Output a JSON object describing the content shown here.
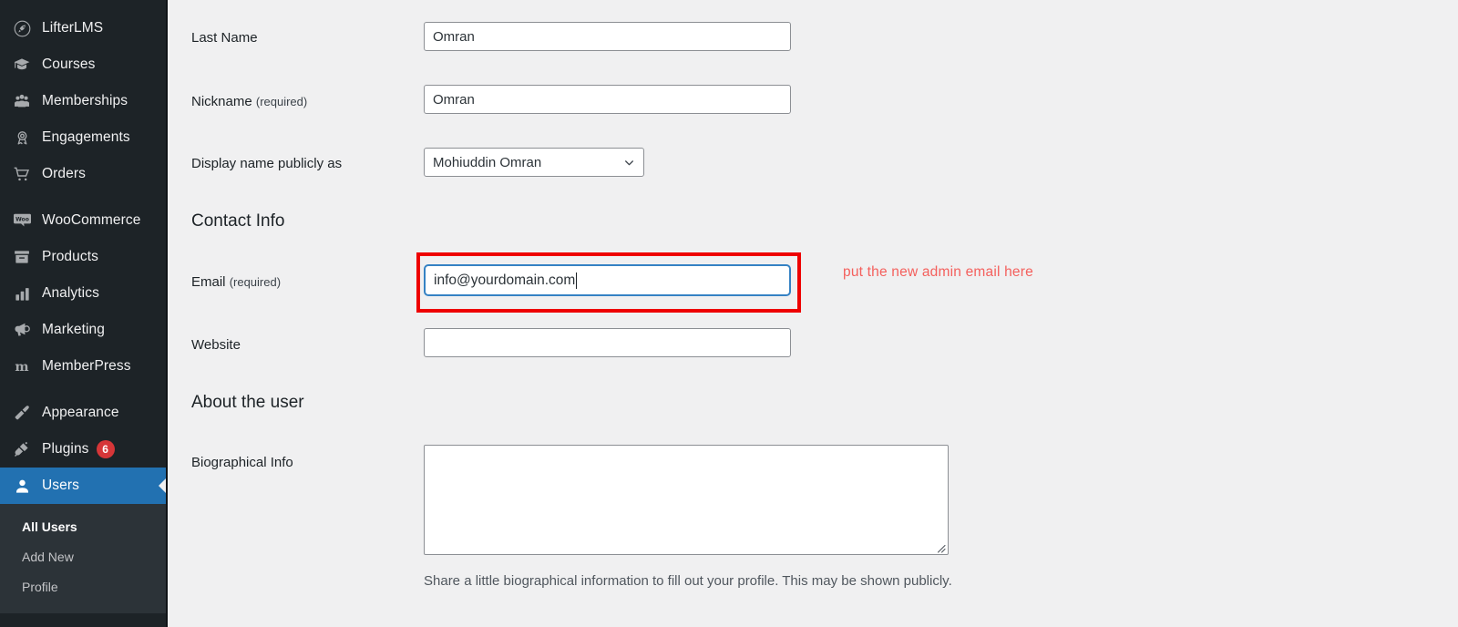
{
  "colors": {
    "sidebar_bg": "#1d2327",
    "submenu_bg": "#2c3338",
    "active_blue": "#2271b1",
    "badge_red": "#d63638",
    "highlight_red": "#ee0000",
    "annotation_red": "#f4605d",
    "focus_blue": "#3582c4",
    "content_bg": "#f0f0f1"
  },
  "sidebar": {
    "groups": [
      {
        "items": [
          {
            "label": "LifterLMS",
            "icon": "rocket-icon",
            "active": false
          },
          {
            "label": "Courses",
            "icon": "graduation-cap-icon",
            "active": false
          },
          {
            "label": "Memberships",
            "icon": "group-icon",
            "active": false
          },
          {
            "label": "Engagements",
            "icon": "award-ribbon-icon",
            "active": false
          },
          {
            "label": "Orders",
            "icon": "shopping-cart-icon",
            "active": false
          }
        ]
      },
      {
        "items": [
          {
            "label": "WooCommerce",
            "icon": "woo-icon",
            "active": false
          },
          {
            "label": "Products",
            "icon": "archive-box-icon",
            "active": false
          },
          {
            "label": "Analytics",
            "icon": "bar-chart-icon",
            "active": false
          },
          {
            "label": "Marketing",
            "icon": "megaphone-icon",
            "active": false
          },
          {
            "label": "MemberPress",
            "icon": "memberpress-m-icon",
            "active": false
          }
        ]
      },
      {
        "items": [
          {
            "label": "Appearance",
            "icon": "paintbrush-icon",
            "active": false
          },
          {
            "label": "Plugins",
            "icon": "plug-icon",
            "active": false,
            "badge": "6"
          },
          {
            "label": "Users",
            "icon": "user-icon",
            "active": true
          }
        ]
      }
    ],
    "submenu": [
      {
        "label": "All Users",
        "current": true
      },
      {
        "label": "Add New",
        "current": false
      },
      {
        "label": "Profile",
        "current": false
      }
    ]
  },
  "form": {
    "last_name": {
      "label": "Last Name",
      "value": "Omran",
      "placeholder": ""
    },
    "nickname": {
      "label": "Nickname",
      "required_note": "(required)",
      "value": "Omran",
      "placeholder": ""
    },
    "display_name": {
      "label": "Display name publicly as",
      "selected": "Mohiuddin Omran",
      "chevron": "chevron-down-icon"
    },
    "contact_info_heading": "Contact Info",
    "email": {
      "label": "Email",
      "required_note": "(required)",
      "value": "info@yourdomain.com",
      "placeholder": ""
    },
    "website": {
      "label": "Website",
      "value": "",
      "placeholder": ""
    },
    "about_heading": "About the user",
    "biographical_info": {
      "label": "Biographical Info",
      "value": "",
      "placeholder": "",
      "description": "Share a little biographical information to fill out your profile. This may be shown publicly."
    }
  },
  "annotation": {
    "text": "put the new admin email here"
  }
}
